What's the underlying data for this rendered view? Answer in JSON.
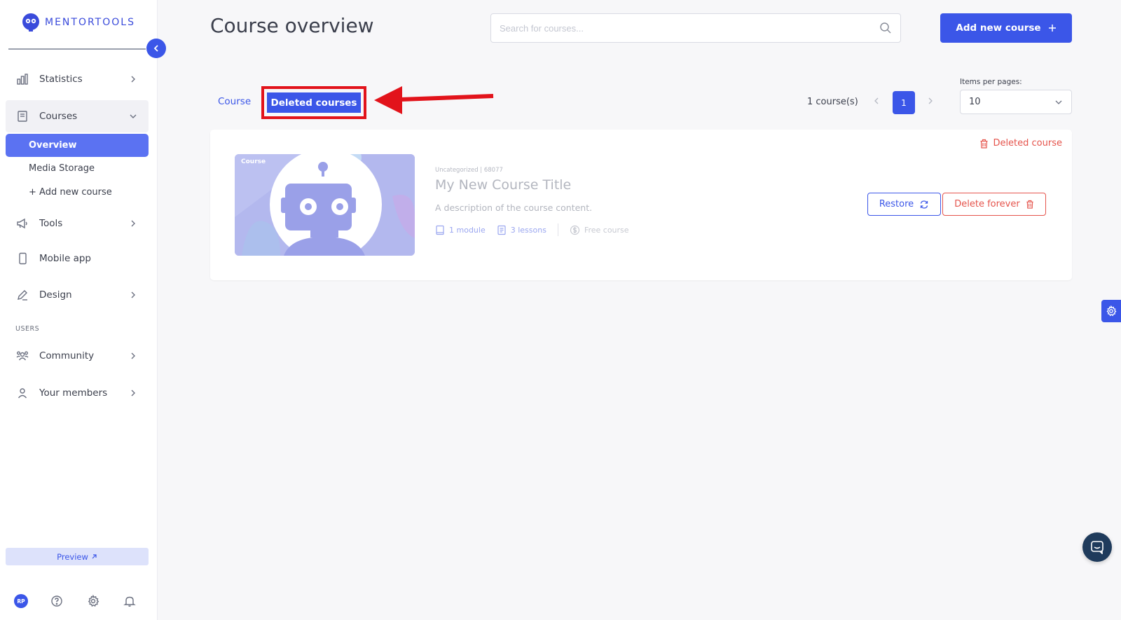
{
  "app": {
    "logo_text": "MENTORTOOLS"
  },
  "sidebar": {
    "items": [
      {
        "label": "Statistics",
        "icon": "bar-chart-icon"
      },
      {
        "label": "Courses",
        "icon": "book-icon"
      },
      {
        "label": "Tools",
        "icon": "megaphone-icon"
      },
      {
        "label": "Mobile app",
        "icon": "phone-icon"
      },
      {
        "label": "Design",
        "icon": "pencil-icon"
      },
      {
        "label": "Community",
        "icon": "community-icon"
      },
      {
        "label": "Your members",
        "icon": "user-icon"
      }
    ],
    "courses_sub": [
      {
        "label": "Overview"
      },
      {
        "label": "Media Storage"
      },
      {
        "label": "+ Add new course"
      }
    ],
    "section_users": "USERS",
    "preview_label": "Preview",
    "avatar_initials": "RP"
  },
  "header": {
    "title": "Course overview",
    "search_placeholder": "Search for courses...",
    "add_button": "Add new course"
  },
  "tabs": {
    "course": "Course",
    "deleted": "Deleted courses"
  },
  "pagination": {
    "count_text": "1 course(s)",
    "current_page": "1",
    "items_per_page_label": "Items per pages:",
    "items_per_page_value": "10"
  },
  "course": {
    "thumb_label": "Course",
    "deleted_flag": "Deleted course",
    "meta": "Uncategorized | 68077",
    "title": "My New Course Title",
    "description": "A description of the course content.",
    "modules": "1 module",
    "lessons": "3 lessons",
    "price": "Free course",
    "restore_label": "Restore",
    "delete_label": "Delete forever"
  },
  "colors": {
    "accent": "#3b56e8",
    "danger": "#e5534b",
    "highlight": "#e2131b"
  }
}
